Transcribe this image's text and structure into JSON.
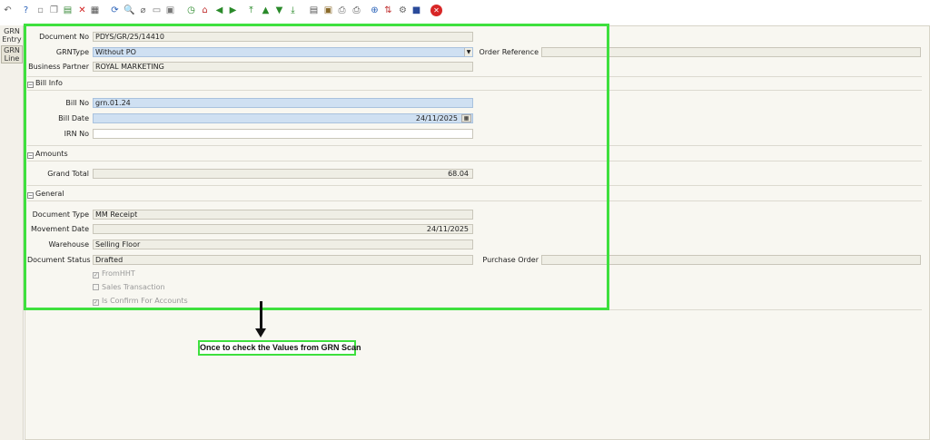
{
  "toolbar": {
    "icons": [
      {
        "name": "undo-icon",
        "glyph": "↶",
        "color": "#666666"
      },
      {
        "name": "help-icon",
        "glyph": "?",
        "color": "#2a62b8"
      },
      {
        "name": "new-record-icon",
        "glyph": "▫",
        "color": "#888888"
      },
      {
        "name": "copy-record-icon",
        "glyph": "❐",
        "color": "#777777"
      },
      {
        "name": "save-icon",
        "glyph": "▤",
        "color": "#3a8a3a"
      },
      {
        "name": "delete-icon",
        "glyph": "✕",
        "color": "#d22222"
      },
      {
        "name": "grid-toggle-icon",
        "glyph": "▦",
        "color": "#555555"
      },
      {
        "name": "refresh-icon",
        "glyph": "⟳",
        "color": "#2a62b8"
      },
      {
        "name": "find-icon",
        "glyph": "🔍",
        "color": "#666666"
      },
      {
        "name": "attachment-icon",
        "glyph": "⌀",
        "color": "#666666"
      },
      {
        "name": "chat-icon",
        "glyph": "▭",
        "color": "#777777"
      },
      {
        "name": "multi-window-icon",
        "glyph": "▣",
        "color": "#777777"
      },
      {
        "name": "history-icon",
        "glyph": "◷",
        "color": "#2a8a2a"
      },
      {
        "name": "home-icon",
        "glyph": "⌂",
        "color": "#c03030"
      },
      {
        "name": "parent-record-icon",
        "glyph": "◀",
        "color": "#2a8a2a"
      },
      {
        "name": "detail-record-icon",
        "glyph": "▶",
        "color": "#2a8a2a"
      },
      {
        "name": "first-record-icon",
        "glyph": "⤒",
        "color": "#2a8a2a"
      },
      {
        "name": "previous-record-icon",
        "glyph": "▲",
        "color": "#2a8a2a"
      },
      {
        "name": "next-record-icon",
        "glyph": "▼",
        "color": "#2a8a2a"
      },
      {
        "name": "last-record-icon",
        "glyph": "⤓",
        "color": "#2a8a2a"
      },
      {
        "name": "report-icon",
        "glyph": "▤",
        "color": "#555555"
      },
      {
        "name": "archive-icon",
        "glyph": "▣",
        "color": "#8a6a2a"
      },
      {
        "name": "print-preview-icon",
        "glyph": "⎙",
        "color": "#666666"
      },
      {
        "name": "print-icon",
        "glyph": "⎙",
        "color": "#555555"
      },
      {
        "name": "zoom-across-icon",
        "glyph": "⊕",
        "color": "#2a62b8"
      },
      {
        "name": "workflow-icon",
        "glyph": "⇅",
        "color": "#c03030"
      },
      {
        "name": "process-icon",
        "glyph": "⚙",
        "color": "#666666"
      },
      {
        "name": "product-info-icon",
        "glyph": "■",
        "color": "#2a4a9a"
      },
      {
        "name": "end-icon",
        "glyph": "✕",
        "color": "#ffffff",
        "bg": "#d82626"
      }
    ]
  },
  "left_tabs": {
    "grn_entry": "GRN Entry",
    "grn_line": "GRN Line"
  },
  "form": {
    "document_no": {
      "label": "Document No",
      "value": "PDYS/GR/25/14410"
    },
    "grn_type": {
      "label": "GRNType",
      "value": "Without PO"
    },
    "order_reference": {
      "label": "Order Reference",
      "value": ""
    },
    "business_partner": {
      "label": "Business Partner",
      "value": "ROYAL MARKETING"
    },
    "bill_info": {
      "title": "Bill Info",
      "bill_no": {
        "label": "Bill No",
        "value": "grn.01.24"
      },
      "bill_date": {
        "label": "Bill Date",
        "value": "24/11/2025"
      },
      "irn_no": {
        "label": "IRN No",
        "value": ""
      }
    },
    "amounts": {
      "title": "Amounts",
      "grand_total": {
        "label": "Grand Total",
        "value": "68.04"
      }
    },
    "general": {
      "title": "General",
      "document_type": {
        "label": "Document Type",
        "value": "MM Receipt"
      },
      "movement_date": {
        "label": "Movement Date",
        "value": "24/11/2025"
      },
      "warehouse": {
        "label": "Warehouse",
        "value": "Selling Floor"
      },
      "document_status": {
        "label": "Document Status",
        "value": "Drafted"
      },
      "purchase_order": {
        "label": "Purchase Order",
        "value": ""
      },
      "from_hht": {
        "label": "FromHHT",
        "checked": true
      },
      "sales_transaction": {
        "label": "Sales Transaction",
        "checked": false
      },
      "is_confirm_for_accounts": {
        "label": "Is Confirm For Accounts",
        "checked": true
      }
    }
  },
  "annotation": {
    "note": "Once to check the Values from  GRN Scan",
    "highlight_color": "#3ee03e"
  }
}
